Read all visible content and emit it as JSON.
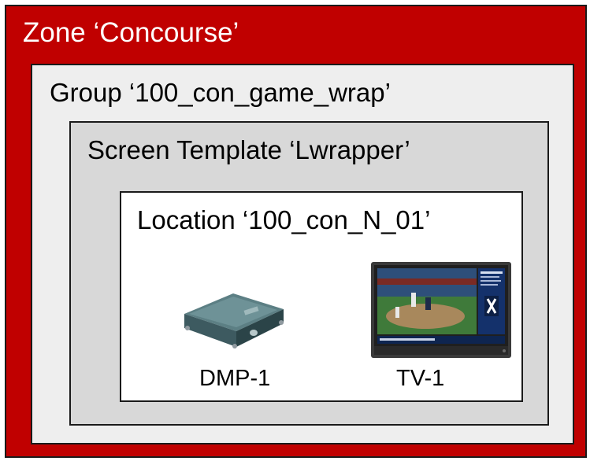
{
  "zone": {
    "title": "Zone ‘Concourse’"
  },
  "group": {
    "title": "Group ‘100_con_game_wrap’"
  },
  "screen_template": {
    "title": "Screen Template ‘Lwrapper’"
  },
  "location": {
    "title": "Location ‘100_con_N_01’",
    "devices": [
      {
        "label": "DMP-1",
        "icon": "media-player-icon"
      },
      {
        "label": "TV-1",
        "icon": "television-icon"
      }
    ]
  },
  "colors": {
    "zone_fill": "#c00000",
    "group_fill": "#eeeeee",
    "template_fill": "#d8d8d8",
    "location_fill": "#ffffff"
  }
}
